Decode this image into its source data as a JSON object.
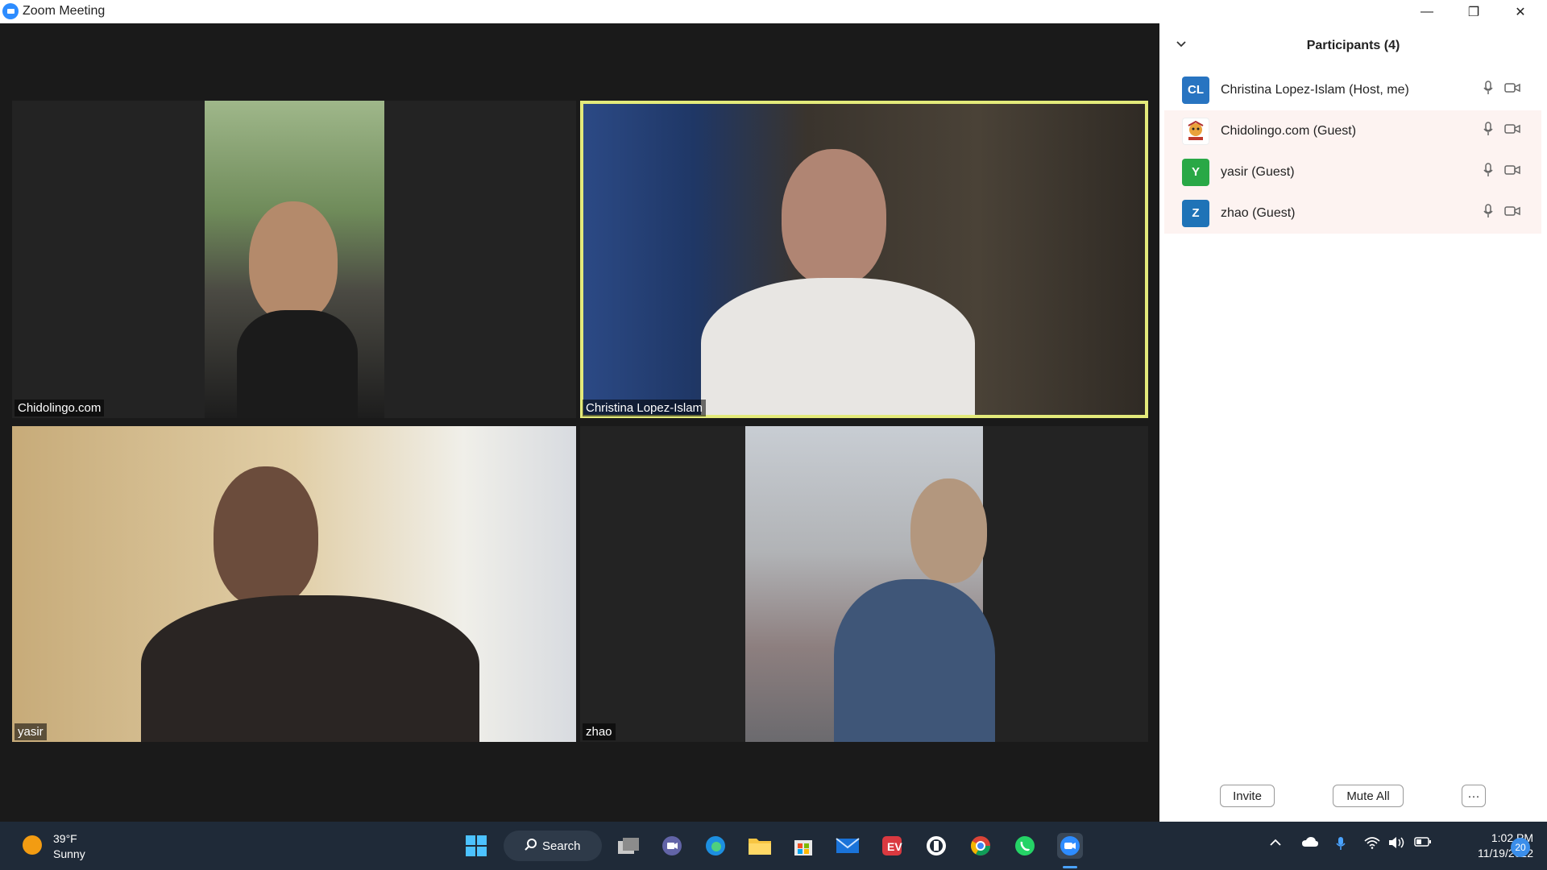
{
  "window": {
    "title": "Zoom Meeting",
    "controls": {
      "minimize": "—",
      "restore": "❐",
      "close": "✕"
    }
  },
  "tiles": [
    {
      "name": "Chidolingo.com",
      "active": false
    },
    {
      "name": "Christina Lopez-Islam",
      "active": true
    },
    {
      "name": "yasir",
      "active": false
    },
    {
      "name": "zhao",
      "active": false
    }
  ],
  "participants": {
    "title": "Participants (4)",
    "list": [
      {
        "initials": "CL",
        "name": "Christina Lopez-Islam (Host, me)",
        "color": "#2874c1"
      },
      {
        "initials": "",
        "name": "Chidolingo.com (Guest)",
        "color": "#ffffff"
      },
      {
        "initials": "Y",
        "name": "yasir (Guest)",
        "color": "#29a846"
      },
      {
        "initials": "Z",
        "name": "zhao (Guest)",
        "color": "#1f73b7"
      }
    ],
    "buttons": {
      "invite": "Invite",
      "mute_all": "Mute All",
      "more": "···"
    }
  },
  "taskbar": {
    "weather_temp": "39°F",
    "weather_cond": "Sunny",
    "search_label": "Search",
    "time": "1:02 PM",
    "date": "11/19/2022",
    "notifications": "20"
  },
  "colors": {
    "accent": "#2d8cff",
    "active_speaker": "#e3ea7a",
    "taskbar_bg": "#1f2a38"
  }
}
